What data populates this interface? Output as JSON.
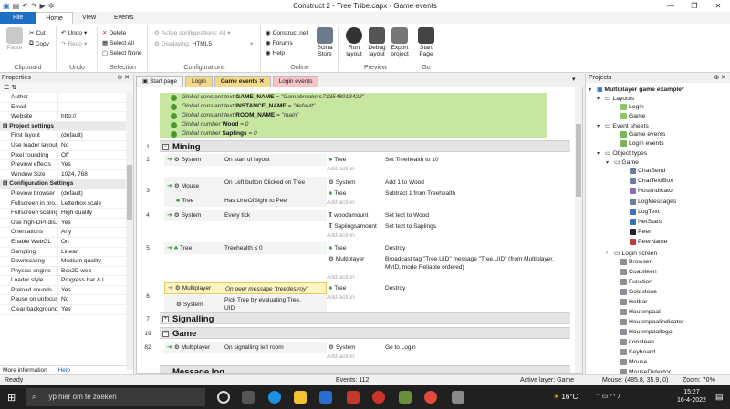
{
  "window": {
    "title": "Construct 2 - Tree Tribe.capx - Game events"
  },
  "ribbon_tabs": [
    "File",
    "Home",
    "View",
    "Events"
  ],
  "ribbon": {
    "clipboard": {
      "paste": "Paste",
      "cut": "Cut",
      "copy": "Copy",
      "label": "Clipboard"
    },
    "undo": {
      "undo": "Undo",
      "redo": "Redo",
      "label": "Undo"
    },
    "selection": {
      "delete": "Delete",
      "select_all": "Select All",
      "select_none": "Select None",
      "label": "Selection"
    },
    "configurations": {
      "active": "Active configurations: All",
      "displaying": "Displaying:",
      "displaying_value": "HTML5",
      "label": "Configurations"
    },
    "online": {
      "construct": "Construct.net",
      "forums": "Forums",
      "help": "Help",
      "scirra_store": "Scirra Store",
      "label": "Online"
    },
    "preview": {
      "run": "Run layout",
      "debug": "Debug layout",
      "export": "Export project",
      "label": "Preview"
    },
    "go": {
      "start_page": "Start Page",
      "label": "Go"
    }
  },
  "properties": {
    "title": "Properties",
    "rows": [
      {
        "k": "Author",
        "v": ""
      },
      {
        "k": "Email",
        "v": ""
      },
      {
        "k": "Website",
        "v": "http://"
      },
      {
        "section": "Project settings"
      },
      {
        "k": "First layout",
        "v": "(default)"
      },
      {
        "k": "Use loader layout",
        "v": "No"
      },
      {
        "k": "Pixel rounding",
        "v": "Off"
      },
      {
        "k": "Preview effects",
        "v": "Yes"
      },
      {
        "k": "Window Size",
        "v": "1024, 768"
      },
      {
        "section": "Configuration Settings"
      },
      {
        "k": "Preview browser",
        "v": "(default)"
      },
      {
        "k": "Fullscreen in bro...",
        "v": "Letterbox scale"
      },
      {
        "k": "Fullscreen scaling",
        "v": "High quality"
      },
      {
        "k": "Use high-DPI dis...",
        "v": "Yes"
      },
      {
        "k": "Orientations",
        "v": "Any"
      },
      {
        "k": "Enable WebGL",
        "v": "On"
      },
      {
        "k": "Sampling",
        "v": "Linear"
      },
      {
        "k": "Downscaling",
        "v": "Medium quality"
      },
      {
        "k": "Physics engine",
        "v": "Box2D web"
      },
      {
        "k": "Loader style",
        "v": "Progress bar & l..."
      },
      {
        "k": "Preload sounds",
        "v": "Yes"
      },
      {
        "k": "Pause on unfocus",
        "v": "No"
      },
      {
        "k": "Clear background",
        "v": "Yes"
      }
    ],
    "more_info": "More information",
    "help_link": "Help"
  },
  "doc_tabs": [
    "Start page",
    "Login",
    "Game events",
    "Login events"
  ],
  "events": {
    "globals": [
      {
        "pre": "Global constant text",
        "name": "GAME_NAME",
        "val": " = \"Gamebreakers713548913422\""
      },
      {
        "pre": "Global constant text",
        "name": "INSTANCE_NAME",
        "val": " = \"default\""
      },
      {
        "pre": "Global constant text",
        "name": "ROOM_NAME",
        "val": " = \"main\""
      },
      {
        "pre": "Global number",
        "name": "Wood",
        "val": " = 0"
      },
      {
        "pre": "Global number",
        "name": "Saplings",
        "val": " = 0"
      }
    ],
    "group_mining": "Mining",
    "group_signalling": "Signalling",
    "group_game": "Game",
    "group_message": "Message log",
    "line_numbers": [
      "1",
      "2",
      "3",
      "4",
      "5",
      "6",
      "7",
      "19",
      "82"
    ],
    "e2": {
      "c_obj": "System",
      "c_txt": "On start of layout",
      "a_obj": "Tree",
      "a_txt": "Set Treehealth to 10"
    },
    "e3": {
      "c1_obj": "Mouse",
      "c1_txt": "On Left button Clicked on Tree",
      "c2_obj": "Tree",
      "c2_txt": "Has LineOfSight to Peer",
      "a1_obj": "System",
      "a1_txt": "Add 1 to Wood",
      "a2_obj": "Tree",
      "a2_txt": "Subtract 1 from Treehealth"
    },
    "e4": {
      "c_obj": "System",
      "c_txt": "Every tick",
      "a1_obj": "woodamount",
      "a1_txt": "Set text to Wood",
      "a2_obj": "Saplingsamount",
      "a2_txt": "Set text to Saplings"
    },
    "e5": {
      "c_obj": "Tree",
      "c_txt": "Treehealth ≤ 0",
      "a1_obj": "Tree",
      "a1_txt": "Destroy",
      "a2_obj": "Multiplayer",
      "a2_txt": "Broadcast tag \"Tree.UID\" message \"Tree.UID\" (from Multiplayer.",
      "a2_txt2": "MyID, mode Reliable ordered)"
    },
    "e6": {
      "c1_obj": "Multiplayer",
      "c1_txt": "On peer message \"treedestroy\"",
      "c2_obj": "System",
      "c2_txt": "Pick Tree by evaluating Tree.",
      "c2_txt2": "UID",
      "a_obj": "Tree",
      "a_txt": "Destroy"
    },
    "e82": {
      "c_obj": "Multiplayer",
      "c_txt": "On signalling left room",
      "a_obj": "System",
      "a_txt": "Go to Login"
    },
    "add_action": "Add action"
  },
  "projects": {
    "title": "Projects",
    "root": "Multiplayer game example*",
    "layouts": "Layouts",
    "layout_items": [
      "Login",
      "Game"
    ],
    "event_sheets": "Event sheets",
    "sheet_items": [
      "Game events",
      "Login events"
    ],
    "object_types": "Object types",
    "game_folder": "Game",
    "game_items": [
      "ChatSend",
      "ChatTextBox",
      "HostIndicator",
      "LogMessages",
      "LogText",
      "NetStats",
      "Peer",
      "PeerName"
    ],
    "login_screen": "Login screen",
    "other_items": [
      "Browser",
      "Coalsteen",
      "Function",
      "Goldstone",
      "Hotbar",
      "Houtenpaal",
      "Houtenpaalindicator",
      "Houtenpaallogo",
      "ironsteen",
      "Keyboard",
      "Mouse",
      "MouseDetector"
    ]
  },
  "status": {
    "ready": "Ready",
    "events": "Events: 112",
    "layer": "Active layer: Game",
    "mouse": "Mouse: (485.8, 35.9, 0)",
    "zoom": "Zoom: 70%"
  },
  "taskbar": {
    "search": "Typ hier om te zoeken",
    "temp": "16°C",
    "time": "15:27",
    "date": "16-4-2022"
  },
  "colors": {
    "accent": "#1e6fc5",
    "event_green": "#c7e6a1",
    "tab_login": "#f2d98a",
    "tab_game": "#f2d98a",
    "tab_login_events": "#f7c4c4"
  }
}
